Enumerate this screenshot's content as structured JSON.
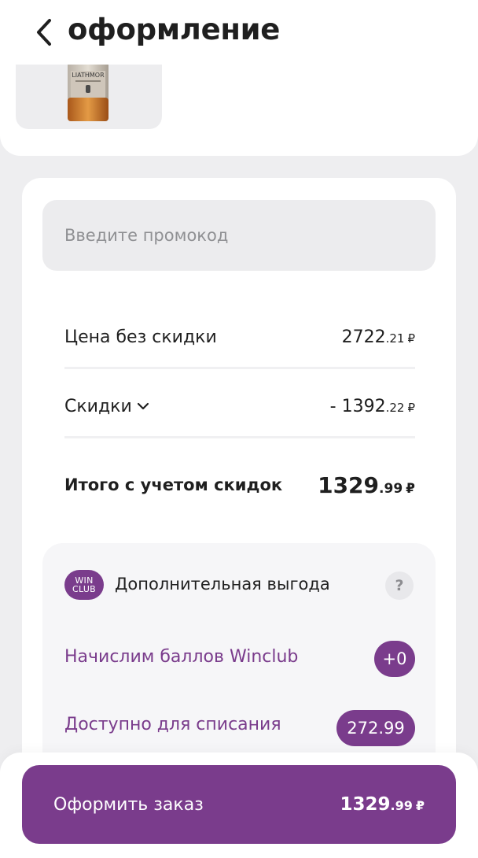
{
  "header": {
    "title": "оформление"
  },
  "product": {
    "brand_text": "LIATHMOR"
  },
  "promo": {
    "placeholder": "Введите промокод"
  },
  "summary": {
    "price_label": "Цена без скидки",
    "price_int": "2722",
    "price_kop": ".21",
    "discount_label": "Скидки",
    "discount_int": "- 1392",
    "discount_kop": ".22",
    "total_label": "Итого с учетом скидок",
    "total_int": "1329",
    "total_kop": ".99",
    "currency": "₽"
  },
  "bonus": {
    "badge_top": "WIN",
    "badge_bottom": "CLUB",
    "title": "Дополнительная выгода",
    "help": "?",
    "accrue_label": "Начислим баллов Winclub",
    "accrue_value": "+0",
    "available_label": "Доступно для списания",
    "available_value": "272.99"
  },
  "cta": {
    "label": "Оформить заказ",
    "amount_int": "1329",
    "amount_kop": ".99",
    "currency": "₽"
  },
  "colors": {
    "accent": "#7a3c8c",
    "background": "#eeeef0"
  }
}
